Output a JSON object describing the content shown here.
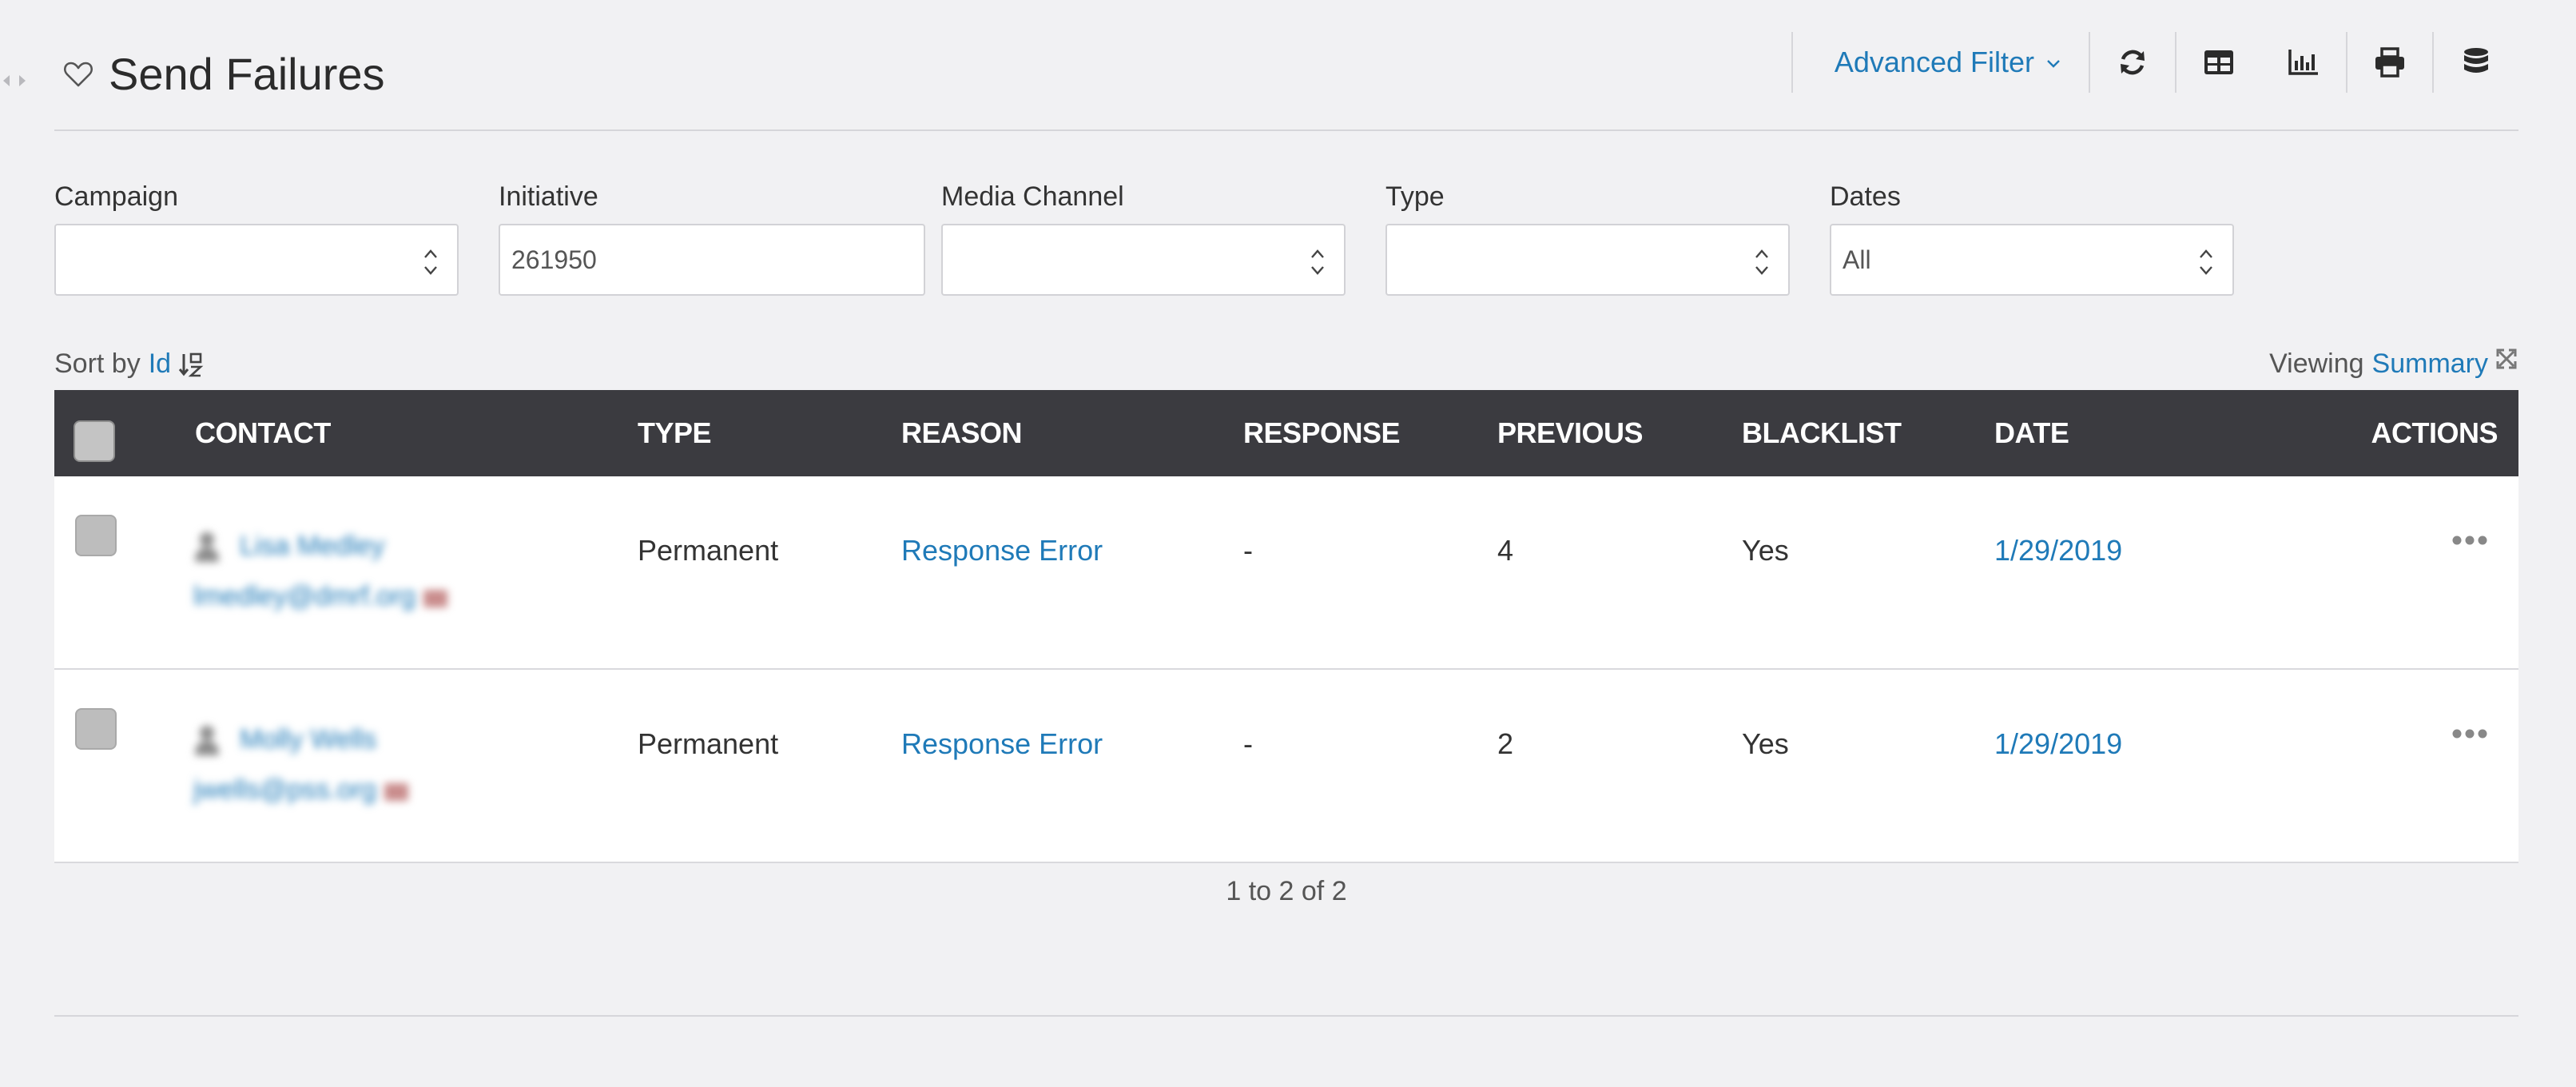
{
  "page": {
    "title": "Send Failures"
  },
  "toolbar": {
    "advanced_filter_label": "Advanced Filter",
    "icons": [
      "refresh-icon",
      "table-view-icon",
      "chart-icon",
      "print-icon",
      "database-icon"
    ]
  },
  "filters": {
    "campaign": {
      "label": "Campaign",
      "value": ""
    },
    "initiative": {
      "label": "Initiative",
      "value": "261950"
    },
    "media_channel": {
      "label": "Media Channel",
      "value": ""
    },
    "type": {
      "label": "Type",
      "value": ""
    },
    "dates": {
      "label": "Dates",
      "value": "All"
    }
  },
  "sort": {
    "prefix": "Sort by",
    "field": "Id",
    "viewing_prefix": "Viewing",
    "viewing_mode": "Summary"
  },
  "table": {
    "columns": [
      "CONTACT",
      "TYPE",
      "REASON",
      "RESPONSE",
      "PREVIOUS",
      "BLACKLIST",
      "DATE",
      "ACTIONS"
    ],
    "rows": [
      {
        "contact_name": "Lisa Medley",
        "contact_email": "lmedley@dmrf.org",
        "type": "Permanent",
        "reason": "Response Error",
        "response": "-",
        "previous": "4",
        "blacklist": "Yes",
        "date": "1/29/2019"
      },
      {
        "contact_name": "Molly Wells",
        "contact_email": "jwells@pss.org",
        "type": "Permanent",
        "reason": "Response Error",
        "response": "-",
        "previous": "2",
        "blacklist": "Yes",
        "date": "1/29/2019"
      }
    ]
  },
  "pager": {
    "summary": "1 to 2 of 2"
  },
  "colors": {
    "accent": "#1f7ab8",
    "header_bg": "#3b3b40",
    "page_bg": "#f1f1f3"
  }
}
